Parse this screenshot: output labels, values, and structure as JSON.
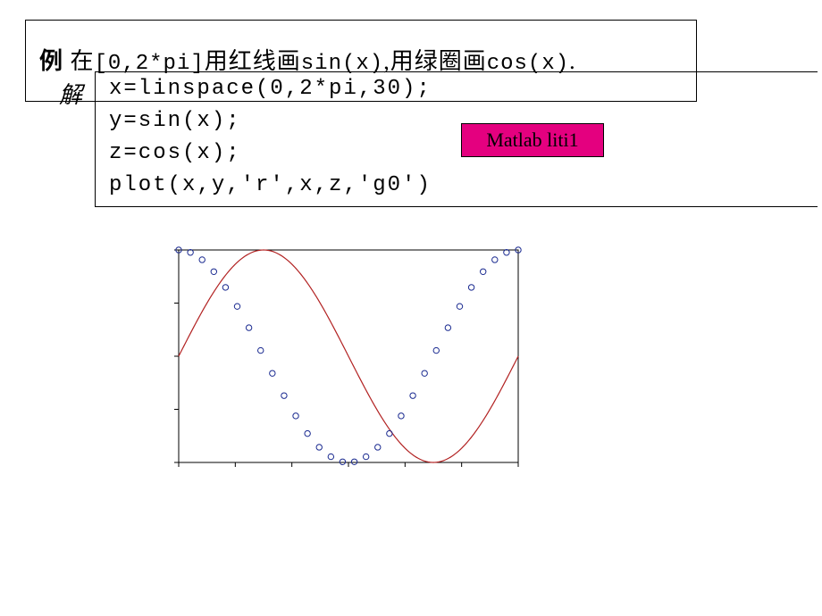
{
  "example": {
    "label": "例",
    "text_pre": " 在",
    "range": "[0,2*pi]",
    "text_mid1": "用红线画",
    "fn1": "sin(x)",
    "text_mid2": ",用绿圈画",
    "fn2": "cos(x)",
    "text_end": "."
  },
  "answer_label": "解",
  "code": {
    "line1": "x=linspace(0,2*pi,30);",
    "line2": "y=sin(x);",
    "line3": "z=cos(x);",
    "line4": "plot(x,y,'r',x,z,'g0')"
  },
  "badge": "Matlab liti1",
  "chart_data": {
    "type": "line+scatter",
    "title": "",
    "xlabel": "",
    "ylabel": "",
    "xlim": [
      0,
      6.283185307
    ],
    "ylim": [
      -1,
      1
    ],
    "xticks_count": 7,
    "yticks_count": 5,
    "series": [
      {
        "name": "sin(x)",
        "style": "red-line",
        "x": [
          0,
          0.2167,
          0.4333,
          0.65,
          0.8667,
          1.0833,
          1.3,
          1.5167,
          1.7333,
          1.95,
          2.1667,
          2.3833,
          2.6,
          2.8167,
          3.0333,
          3.25,
          3.4667,
          3.6833,
          3.9,
          4.1167,
          4.3333,
          4.55,
          4.7667,
          4.9833,
          5.2,
          5.4167,
          5.6333,
          5.85,
          6.0667,
          6.2832
        ],
        "y": [
          0,
          0.215,
          0.42,
          0.605,
          0.762,
          0.883,
          0.964,
          0.999,
          0.987,
          0.929,
          0.827,
          0.685,
          0.516,
          0.324,
          0.108,
          -0.108,
          -0.324,
          -0.516,
          -0.685,
          -0.827,
          -0.929,
          -0.987,
          -0.999,
          -0.964,
          -0.883,
          -0.762,
          -0.605,
          -0.42,
          -0.215,
          0
        ]
      },
      {
        "name": "cos(x)",
        "style": "blue-circles",
        "x": [
          0,
          0.2167,
          0.4333,
          0.65,
          0.8667,
          1.0833,
          1.3,
          1.5167,
          1.7333,
          1.95,
          2.1667,
          2.3833,
          2.6,
          2.8167,
          3.0333,
          3.25,
          3.4667,
          3.6833,
          3.9,
          4.1167,
          4.3333,
          4.55,
          4.7667,
          4.9833,
          5.2,
          5.4167,
          5.6333,
          5.85,
          6.0667,
          6.2832
        ],
        "y": [
          1,
          0.977,
          0.908,
          0.796,
          0.648,
          0.469,
          0.268,
          0.054,
          -0.161,
          -0.371,
          -0.562,
          -0.728,
          -0.857,
          -0.946,
          -0.994,
          -0.994,
          -0.946,
          -0.857,
          -0.728,
          -0.562,
          -0.371,
          -0.161,
          0.054,
          0.268,
          0.469,
          0.648,
          0.796,
          0.908,
          0.977,
          1
        ]
      }
    ]
  }
}
